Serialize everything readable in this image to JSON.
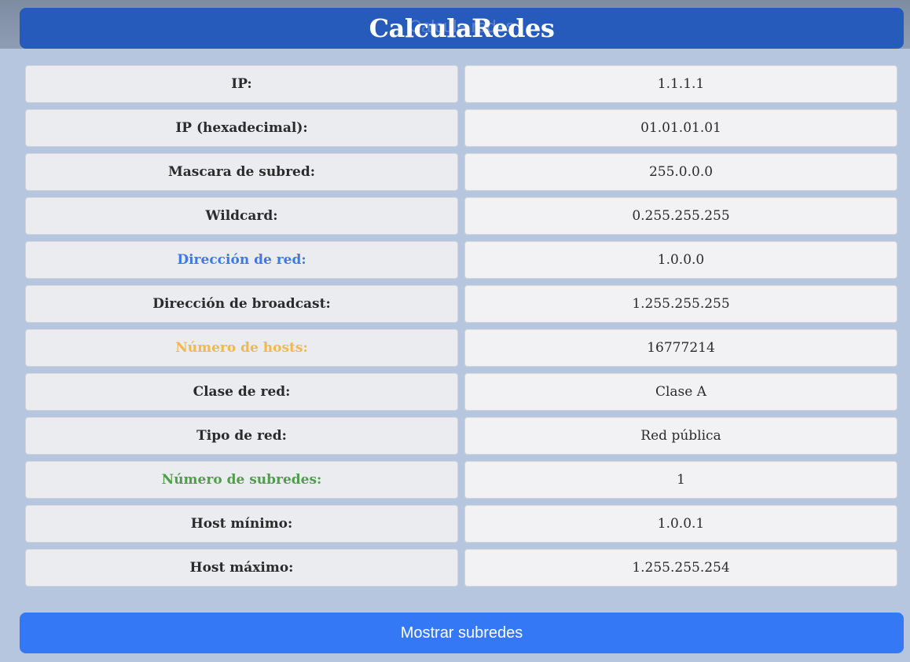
{
  "header": {
    "title": "CalculaRedes",
    "ghost_text": "Calcula redes"
  },
  "colors": {
    "header_bg": "#275bbb",
    "button_bg": "#3478f6",
    "network_address_label": "#3d7ae6",
    "hosts_label": "#f2b84b",
    "subnets_label": "#4e9f48"
  },
  "rows": [
    {
      "label": "IP:",
      "value": "1.1.1.1",
      "color": ""
    },
    {
      "label": "IP (hexadecimal):",
      "value": "01.01.01.01",
      "color": ""
    },
    {
      "label": "Mascara de subred:",
      "value": "255.0.0.0",
      "color": ""
    },
    {
      "label": "Wildcard:",
      "value": "0.255.255.255",
      "color": ""
    },
    {
      "label": "Dirección de red:",
      "value": "1.0.0.0",
      "color": "#3d7ae6"
    },
    {
      "label": "Dirección de broadcast:",
      "value": "1.255.255.255",
      "color": ""
    },
    {
      "label": "Número de hosts:",
      "value": "16777214",
      "color": "#f2b84b"
    },
    {
      "label": "Clase de red:",
      "value": "Clase A",
      "color": ""
    },
    {
      "label": "Tipo de red:",
      "value": "Red pública",
      "color": ""
    },
    {
      "label": "Número de subredes:",
      "value": "1",
      "color": "#4e9f48"
    },
    {
      "label": "Host mínimo:",
      "value": "1.0.0.1",
      "color": ""
    },
    {
      "label": "Host máximo:",
      "value": "1.255.255.254",
      "color": ""
    }
  ],
  "button": {
    "show_subnets_label": "Mostrar subredes"
  }
}
